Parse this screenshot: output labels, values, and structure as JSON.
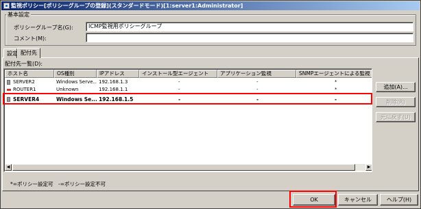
{
  "window": {
    "title": "監視ポリシー[ポリシーグループの登録](スタンダードモード)[1:server1:Administrator]"
  },
  "basic": {
    "group_label": "基本設定",
    "name_label": "ポリシーグループ名(G):",
    "name_value": "ICMP監視用ポリシーグループ",
    "comment_label": "コメント(M):",
    "comment_value": ""
  },
  "tabs": [
    {
      "label": "設定",
      "active": false
    },
    {
      "label": "配付先",
      "active": true
    }
  ],
  "list": {
    "label": "配付先一覧(D):",
    "columns": [
      "ホスト名",
      "OS種別",
      "IPアドレス",
      "インストール型エージェント",
      "アプリケーション監視",
      "SNMPエージェントによる監視"
    ],
    "rows": [
      {
        "host": "SERVER2",
        "os": "Windows Serve...",
        "ip": "192.168.1.3",
        "install_agent": "-",
        "app_monitor": "-",
        "snmp": "*",
        "icon": "server-icon"
      },
      {
        "host": "ROUTER1",
        "os": "Unknown",
        "ip": "192.168.1.1",
        "install_agent": "-",
        "app_monitor": "-",
        "snmp": "*",
        "icon": "router-icon"
      },
      {
        "host": "SERVER4",
        "os": "Windows Se...",
        "ip": "192.168.1.5",
        "install_agent": "-",
        "app_monitor": "-",
        "snmp": "-",
        "icon": "server-icon"
      }
    ],
    "scroll_left": "◀",
    "scroll_right": "▶"
  },
  "side_buttons": {
    "add": "追加(A)...",
    "delete": "削除(R)",
    "restore": "元に戻す(U)"
  },
  "legend": "*=ポリシー設定可　-=ポリシー設定不可",
  "footer": {
    "ok": "OK",
    "cancel": "キャンセル",
    "help": "ヘルプ(H)"
  },
  "colors": {
    "highlight": "#ff0000",
    "title_start": "#0a246a",
    "title_end": "#a6caf0",
    "face": "#d4d0c8"
  }
}
